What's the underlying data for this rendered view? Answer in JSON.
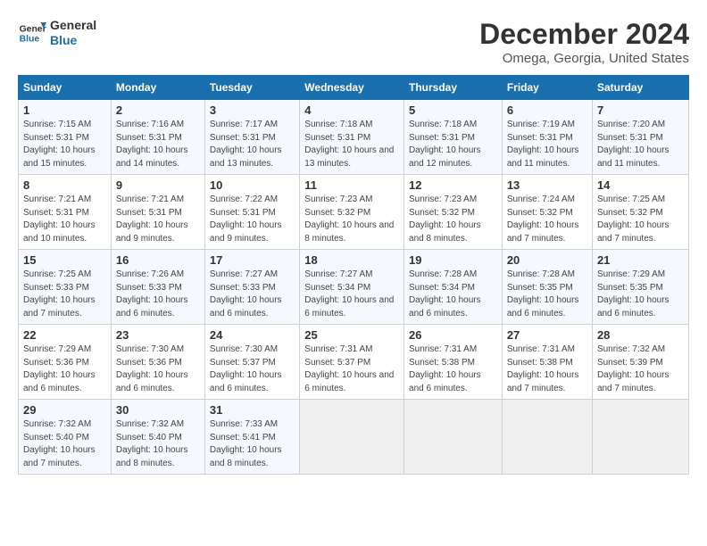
{
  "logo": {
    "text_general": "General",
    "text_blue": "Blue"
  },
  "title": "December 2024",
  "subtitle": "Omega, Georgia, United States",
  "calendar": {
    "headers": [
      "Sunday",
      "Monday",
      "Tuesday",
      "Wednesday",
      "Thursday",
      "Friday",
      "Saturday"
    ],
    "weeks": [
      [
        {
          "day": "1",
          "sunrise": "7:15 AM",
          "sunset": "5:31 PM",
          "daylight": "10 hours and 15 minutes."
        },
        {
          "day": "2",
          "sunrise": "7:16 AM",
          "sunset": "5:31 PM",
          "daylight": "10 hours and 14 minutes."
        },
        {
          "day": "3",
          "sunrise": "7:17 AM",
          "sunset": "5:31 PM",
          "daylight": "10 hours and 13 minutes."
        },
        {
          "day": "4",
          "sunrise": "7:18 AM",
          "sunset": "5:31 PM",
          "daylight": "10 hours and 13 minutes."
        },
        {
          "day": "5",
          "sunrise": "7:18 AM",
          "sunset": "5:31 PM",
          "daylight": "10 hours and 12 minutes."
        },
        {
          "day": "6",
          "sunrise": "7:19 AM",
          "sunset": "5:31 PM",
          "daylight": "10 hours and 11 minutes."
        },
        {
          "day": "7",
          "sunrise": "7:20 AM",
          "sunset": "5:31 PM",
          "daylight": "10 hours and 11 minutes."
        }
      ],
      [
        {
          "day": "8",
          "sunrise": "7:21 AM",
          "sunset": "5:31 PM",
          "daylight": "10 hours and 10 minutes."
        },
        {
          "day": "9",
          "sunrise": "7:21 AM",
          "sunset": "5:31 PM",
          "daylight": "10 hours and 9 minutes."
        },
        {
          "day": "10",
          "sunrise": "7:22 AM",
          "sunset": "5:31 PM",
          "daylight": "10 hours and 9 minutes."
        },
        {
          "day": "11",
          "sunrise": "7:23 AM",
          "sunset": "5:32 PM",
          "daylight": "10 hours and 8 minutes."
        },
        {
          "day": "12",
          "sunrise": "7:23 AM",
          "sunset": "5:32 PM",
          "daylight": "10 hours and 8 minutes."
        },
        {
          "day": "13",
          "sunrise": "7:24 AM",
          "sunset": "5:32 PM",
          "daylight": "10 hours and 7 minutes."
        },
        {
          "day": "14",
          "sunrise": "7:25 AM",
          "sunset": "5:32 PM",
          "daylight": "10 hours and 7 minutes."
        }
      ],
      [
        {
          "day": "15",
          "sunrise": "7:25 AM",
          "sunset": "5:33 PM",
          "daylight": "10 hours and 7 minutes."
        },
        {
          "day": "16",
          "sunrise": "7:26 AM",
          "sunset": "5:33 PM",
          "daylight": "10 hours and 6 minutes."
        },
        {
          "day": "17",
          "sunrise": "7:27 AM",
          "sunset": "5:33 PM",
          "daylight": "10 hours and 6 minutes."
        },
        {
          "day": "18",
          "sunrise": "7:27 AM",
          "sunset": "5:34 PM",
          "daylight": "10 hours and 6 minutes."
        },
        {
          "day": "19",
          "sunrise": "7:28 AM",
          "sunset": "5:34 PM",
          "daylight": "10 hours and 6 minutes."
        },
        {
          "day": "20",
          "sunrise": "7:28 AM",
          "sunset": "5:35 PM",
          "daylight": "10 hours and 6 minutes."
        },
        {
          "day": "21",
          "sunrise": "7:29 AM",
          "sunset": "5:35 PM",
          "daylight": "10 hours and 6 minutes."
        }
      ],
      [
        {
          "day": "22",
          "sunrise": "7:29 AM",
          "sunset": "5:36 PM",
          "daylight": "10 hours and 6 minutes."
        },
        {
          "day": "23",
          "sunrise": "7:30 AM",
          "sunset": "5:36 PM",
          "daylight": "10 hours and 6 minutes."
        },
        {
          "day": "24",
          "sunrise": "7:30 AM",
          "sunset": "5:37 PM",
          "daylight": "10 hours and 6 minutes."
        },
        {
          "day": "25",
          "sunrise": "7:31 AM",
          "sunset": "5:37 PM",
          "daylight": "10 hours and 6 minutes."
        },
        {
          "day": "26",
          "sunrise": "7:31 AM",
          "sunset": "5:38 PM",
          "daylight": "10 hours and 6 minutes."
        },
        {
          "day": "27",
          "sunrise": "7:31 AM",
          "sunset": "5:38 PM",
          "daylight": "10 hours and 7 minutes."
        },
        {
          "day": "28",
          "sunrise": "7:32 AM",
          "sunset": "5:39 PM",
          "daylight": "10 hours and 7 minutes."
        }
      ],
      [
        {
          "day": "29",
          "sunrise": "7:32 AM",
          "sunset": "5:40 PM",
          "daylight": "10 hours and 7 minutes."
        },
        {
          "day": "30",
          "sunrise": "7:32 AM",
          "sunset": "5:40 PM",
          "daylight": "10 hours and 8 minutes."
        },
        {
          "day": "31",
          "sunrise": "7:33 AM",
          "sunset": "5:41 PM",
          "daylight": "10 hours and 8 minutes."
        },
        null,
        null,
        null,
        null
      ]
    ]
  }
}
